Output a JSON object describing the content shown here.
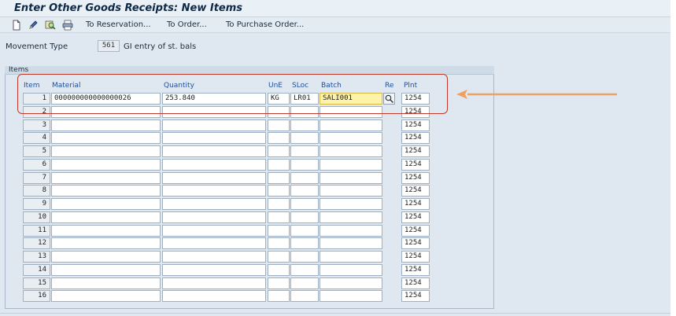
{
  "window": {
    "title": "Enter Other Goods Receipts: New Items"
  },
  "toolbar": {
    "icons": [
      "new-document-icon",
      "edit-pencil-icon",
      "display-search-icon",
      "print-icon"
    ],
    "links": [
      "To Reservation...",
      "To Order...",
      "To Purchase Order..."
    ]
  },
  "movement": {
    "label": "Movement Type",
    "code": "561",
    "description": "GI entry of st. bals"
  },
  "items_group": {
    "title": "Items"
  },
  "columns": [
    "Item",
    "Material",
    "Quantity",
    "UnE",
    "SLoc",
    "Batch",
    "Re",
    "Plnt"
  ],
  "rows": [
    {
      "item": "1",
      "material": "000000000000000026",
      "quantity": "253.840",
      "unit": "KG",
      "sloc": "LR01",
      "batch": "SALI001",
      "plant": "1254"
    },
    {
      "item": "2",
      "material": "",
      "quantity": "",
      "unit": "",
      "sloc": "",
      "batch": "",
      "plant": "1254"
    },
    {
      "item": "3",
      "material": "",
      "quantity": "",
      "unit": "",
      "sloc": "",
      "batch": "",
      "plant": "1254"
    },
    {
      "item": "4",
      "material": "",
      "quantity": "",
      "unit": "",
      "sloc": "",
      "batch": "",
      "plant": "1254"
    },
    {
      "item": "5",
      "material": "",
      "quantity": "",
      "unit": "",
      "sloc": "",
      "batch": "",
      "plant": "1254"
    },
    {
      "item": "6",
      "material": "",
      "quantity": "",
      "unit": "",
      "sloc": "",
      "batch": "",
      "plant": "1254"
    },
    {
      "item": "7",
      "material": "",
      "quantity": "",
      "unit": "",
      "sloc": "",
      "batch": "",
      "plant": "1254"
    },
    {
      "item": "8",
      "material": "",
      "quantity": "",
      "unit": "",
      "sloc": "",
      "batch": "",
      "plant": "1254"
    },
    {
      "item": "9",
      "material": "",
      "quantity": "",
      "unit": "",
      "sloc": "",
      "batch": "",
      "plant": "1254"
    },
    {
      "item": "10",
      "material": "",
      "quantity": "",
      "unit": "",
      "sloc": "",
      "batch": "",
      "plant": "1254"
    },
    {
      "item": "11",
      "material": "",
      "quantity": "",
      "unit": "",
      "sloc": "",
      "batch": "",
      "plant": "1254"
    },
    {
      "item": "12",
      "material": "",
      "quantity": "",
      "unit": "",
      "sloc": "",
      "batch": "",
      "plant": "1254"
    },
    {
      "item": "13",
      "material": "",
      "quantity": "",
      "unit": "",
      "sloc": "",
      "batch": "",
      "plant": "1254"
    },
    {
      "item": "14",
      "material": "",
      "quantity": "",
      "unit": "",
      "sloc": "",
      "batch": "",
      "plant": "1254"
    },
    {
      "item": "15",
      "material": "",
      "quantity": "",
      "unit": "",
      "sloc": "",
      "batch": "",
      "plant": "1254"
    },
    {
      "item": "16",
      "material": "",
      "quantity": "",
      "unit": "",
      "sloc": "",
      "batch": "",
      "plant": "1254"
    }
  ],
  "colors": {
    "highlight": "#c0392b",
    "arrow": "#f0a060",
    "header_text": "#1f4e9a",
    "active_batch": "#fff3a8"
  }
}
